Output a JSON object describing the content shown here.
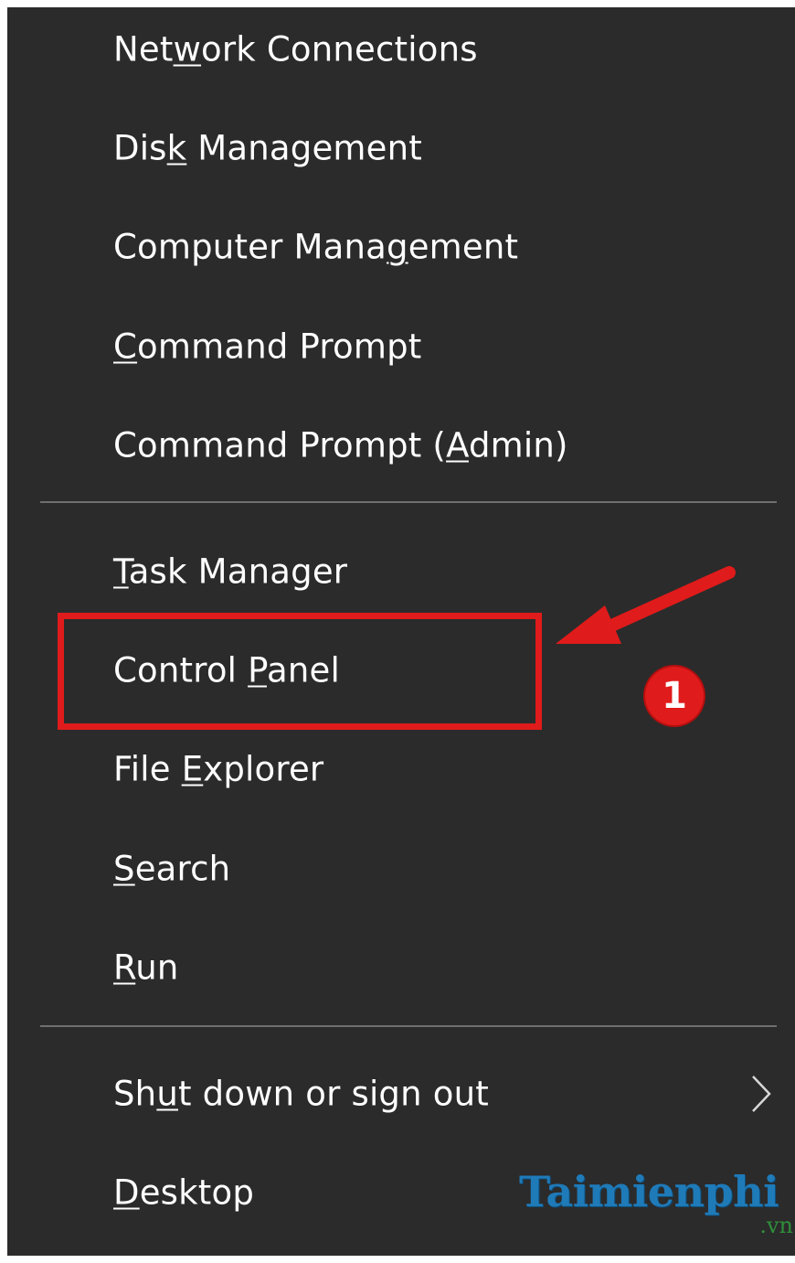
{
  "menu": {
    "items": [
      {
        "label": "Network Connections",
        "access_key": "w"
      },
      {
        "label": "Disk Management",
        "access_key": "k"
      },
      {
        "label": "Computer Management",
        "access_key": "g"
      },
      {
        "label": "Command Prompt",
        "access_key": "C"
      },
      {
        "label": "Command Prompt (Admin)",
        "access_key": "A"
      },
      {
        "label": "Task Manager",
        "access_key": "T"
      },
      {
        "label": "Control Panel",
        "access_key": "P"
      },
      {
        "label": "File Explorer",
        "access_key": "E"
      },
      {
        "label": "Search",
        "access_key": "S"
      },
      {
        "label": "Run",
        "access_key": "R"
      },
      {
        "label": "Shut down or sign out",
        "access_key": "u",
        "submenu_icon": "chevron-right-icon"
      },
      {
        "label": "Desktop",
        "access_key": "D"
      }
    ]
  },
  "annotation": {
    "step_number": "1",
    "highlighted_item": "Control Panel",
    "color": "#e01b1b"
  },
  "watermark": {
    "main": "Taimienphi",
    "sub": ".vn"
  },
  "colors": {
    "menu_background": "#2b2b2b",
    "text": "#ffffff",
    "separator": "#6f6f6f",
    "watermark_blue": "#1f7ab8",
    "watermark_green": "#2f8f3a"
  }
}
